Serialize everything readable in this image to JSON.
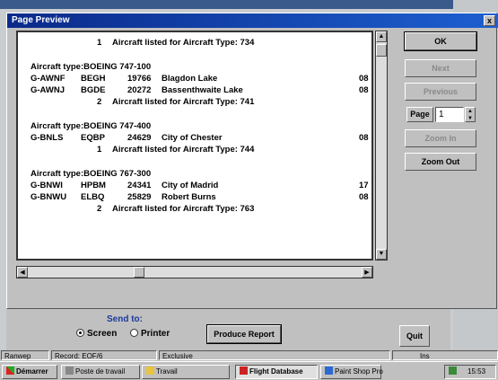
{
  "window": {
    "title": "Page Preview",
    "close_glyph": "x"
  },
  "report": {
    "lines": [
      {
        "kind": "total",
        "count": "1",
        "text": "Aircraft listed for Aircraft Type: 734"
      },
      {
        "kind": "type",
        "text": "Aircraft type:BOEING 747-100"
      },
      {
        "kind": "row",
        "reg": "G-AWNF",
        "code": "BEGH",
        "num": "19766",
        "name": "Blagdon Lake",
        "tail": "08"
      },
      {
        "kind": "row",
        "reg": "G-AWNJ",
        "code": "BGDE",
        "num": "20272",
        "name": "Bassenthwaite Lake",
        "tail": "08"
      },
      {
        "kind": "total",
        "count": "2",
        "text": "Aircraft listed for Aircraft Type: 741"
      },
      {
        "kind": "type",
        "text": "Aircraft type:BOEING 747-400"
      },
      {
        "kind": "row",
        "reg": "G-BNLS",
        "code": "EQBP",
        "num": "24629",
        "name": "City of Chester",
        "tail": "08"
      },
      {
        "kind": "total",
        "count": "1",
        "text": "Aircraft listed for Aircraft Type: 744"
      },
      {
        "kind": "type",
        "text": "Aircraft type:BOEING 767-300"
      },
      {
        "kind": "row",
        "reg": "G-BNWI",
        "code": "HPBM",
        "num": "24341",
        "name": "City of Madrid",
        "tail": "17"
      },
      {
        "kind": "row",
        "reg": "G-BNWU",
        "code": "ELBQ",
        "num": "25829",
        "name": "Robert Burns",
        "tail": "08"
      },
      {
        "kind": "total",
        "count": "2",
        "text": "Aircraft listed for Aircraft Type: 763"
      }
    ]
  },
  "buttons": {
    "ok": "OK",
    "next": "Next",
    "previous": "Previous",
    "page": "Page",
    "page_value": "1",
    "zoom_in": "Zoom In",
    "zoom_out": "Zoom Out"
  },
  "form": {
    "send_to": "Send to:",
    "screen": "Screen",
    "printer": "Printer",
    "produce": "Produce Report",
    "quit": "Quit"
  },
  "statusbar": {
    "left": "Ranwep",
    "record": "Record: EOF/6",
    "mode": "Exclusive",
    "ins": "Ins"
  },
  "taskbar": {
    "start": "Démarrer",
    "poste": "Poste de travail",
    "travail": "Travail",
    "flight": "Flight Database",
    "psp": "Paint Shop Pro",
    "clock": "15:53"
  },
  "colors": {
    "titlebar": "#0a2a8a",
    "send_to": "#1a3a9a"
  },
  "icons": {
    "up": "▲",
    "down": "▼",
    "left": "◀",
    "right": "▶"
  }
}
